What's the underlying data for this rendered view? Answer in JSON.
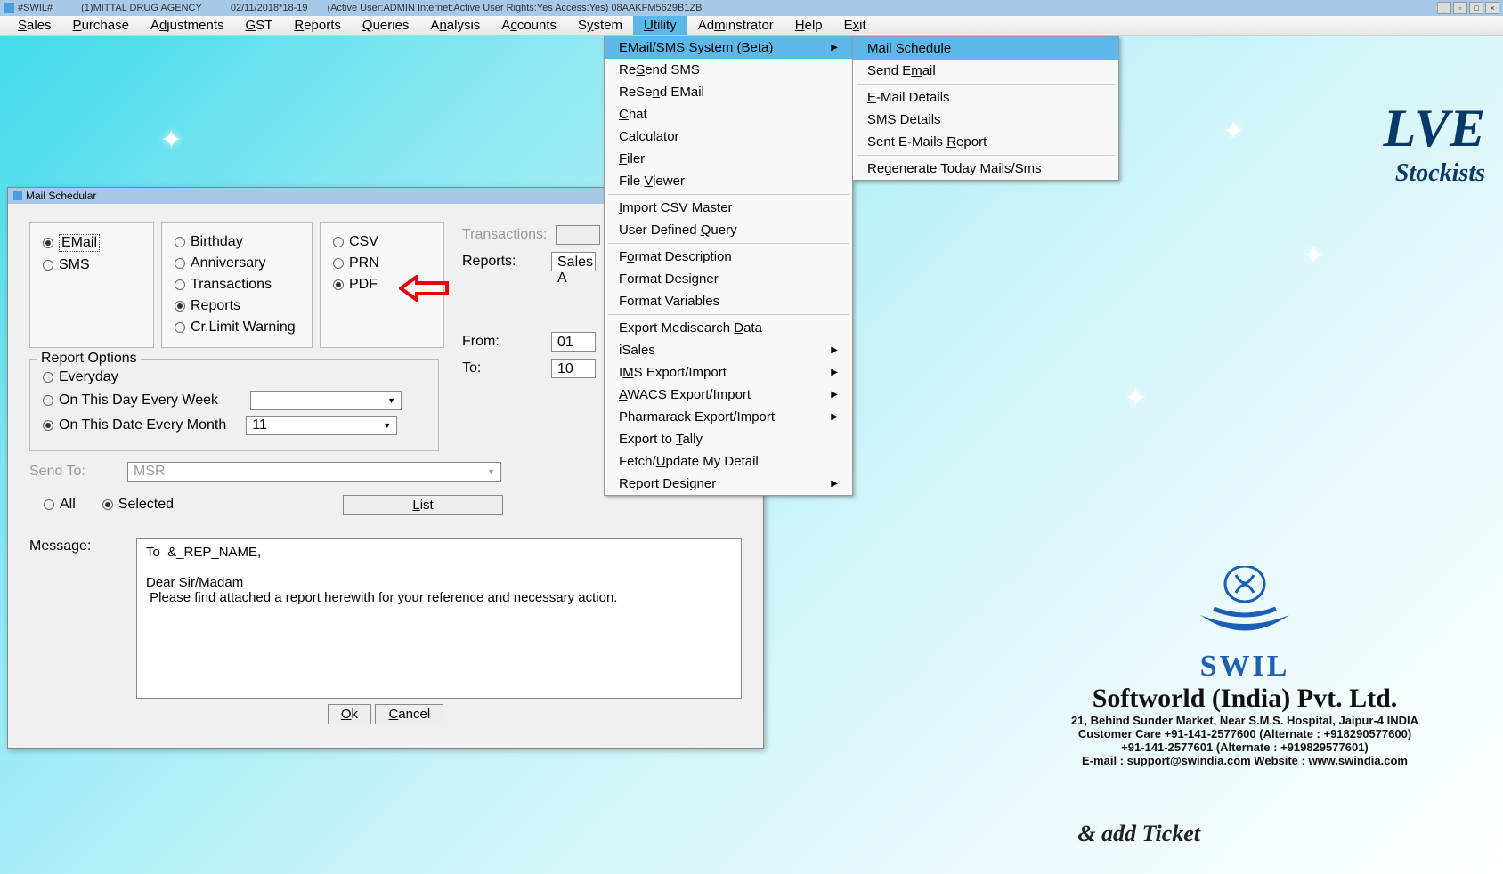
{
  "titlebar": {
    "app": "#SWIL#",
    "company": "(1)MITTAL DRUG AGENCY",
    "datetime": "02/11/2018*18-19",
    "status": "(Active User:ADMIN Internet:Active  User Rights:Yes Access:Yes) 08AAKFM5629B1ZB"
  },
  "menubar": {
    "items": [
      "Sales",
      "Purchase",
      "Adjustments",
      "GST",
      "Reports",
      "Queries",
      "Analysis",
      "Accounts",
      "System",
      "Utility",
      "Adminstrator",
      "Help",
      "Exit"
    ],
    "active": "Utility"
  },
  "utility_menu": {
    "items": [
      {
        "label": "EMail/SMS System (Beta)",
        "submenu": true,
        "highlighted": true,
        "u": "E"
      },
      {
        "label": "ReSend SMS",
        "u": "S"
      },
      {
        "label": "ReSend EMail",
        "u": "n"
      },
      {
        "label": "Chat",
        "u": "C"
      },
      {
        "label": "Calculator",
        "u": "a"
      },
      {
        "label": "Filer",
        "u": "F"
      },
      {
        "label": "File Viewer",
        "u": "V"
      },
      {
        "sep": true
      },
      {
        "label": "Import CSV Master",
        "u": "I"
      },
      {
        "label": "User Defined Query",
        "u": "Q"
      },
      {
        "sep": true
      },
      {
        "label": "Format Description",
        "u": "o"
      },
      {
        "label": "Format Designer"
      },
      {
        "label": "Format Variables"
      },
      {
        "sep": true
      },
      {
        "label": "Export Medisearch Data",
        "u": "D"
      },
      {
        "label": "iSales",
        "submenu": true
      },
      {
        "label": "IMS Export/Import",
        "submenu": true,
        "u": "M"
      },
      {
        "label": "AWACS Export/Import",
        "submenu": true,
        "u": "A"
      },
      {
        "label": "Pharmarack Export/Import",
        "submenu": true
      },
      {
        "label": "Export to Tally",
        "u": "T"
      },
      {
        "label": "Fetch/Update My Detail",
        "u": "U"
      },
      {
        "label": "Report Designer",
        "submenu": true
      }
    ]
  },
  "email_submenu": {
    "items": [
      {
        "label": "Mail Schedule",
        "highlighted": true
      },
      {
        "label": "Send Email",
        "u": "m"
      },
      {
        "sep": true
      },
      {
        "label": "E-Mail Details",
        "u": "E"
      },
      {
        "label": "SMS Details",
        "u": "S"
      },
      {
        "label": "Sent E-Mails Report",
        "u": "R"
      },
      {
        "sep": true
      },
      {
        "label": "Regenerate Today Mails/Sms",
        "u": "T"
      }
    ]
  },
  "mail_dialog": {
    "title": "Mail Schedular",
    "type_group": {
      "email": "EMail",
      "sms": "SMS",
      "selected": "EMail"
    },
    "category_group": {
      "options": [
        "Birthday",
        "Anniversary",
        "Transactions",
        "Reports",
        "Cr.Limit Warning"
      ],
      "selected": "Reports"
    },
    "format_group": {
      "options": [
        "CSV",
        "PRN",
        "PDF"
      ],
      "selected": "PDF"
    },
    "right_labels": {
      "transactions": "Transactions:",
      "reports": "Reports:",
      "reports_value": "Sales A",
      "from": "From:",
      "from_value": "01",
      "to": "To:",
      "to_value": "10"
    },
    "report_options": {
      "legend": "Report Options",
      "everyday": "Everyday",
      "weekly": "On This Day Every Week",
      "monthly": "On This Date Every Month",
      "selected": "monthly",
      "monthly_value": "11"
    },
    "sendto": {
      "label": "Send To:",
      "value": "MSR"
    },
    "selection": {
      "all": "All",
      "selected": "Selected",
      "checked": "Selected",
      "list_btn": "List"
    },
    "message": {
      "label": "Message:",
      "text": "To  &_REP_NAME,\n\nDear Sir/Madam\n Please find attached a report herewith for your reference and necessary action."
    },
    "buttons": {
      "ok": "Ok",
      "cancel": "Cancel"
    }
  },
  "brand": {
    "name": "SWIL",
    "company": "Softworld (India) Pvt. Ltd.",
    "addr": "21, Behind Sunder Market, Near S.M.S. Hospital, Jaipur-4 INDIA",
    "care1": "Customer Care     +91-141-2577600 (Alternate : +918290577600)",
    "care2": "+91-141-2577601 (Alternate : +919829577601)",
    "email": "E-mail : support@swindia.com   Website : www.swindia.com"
  },
  "bg": {
    "lve": "LVE",
    "stock": "Stockists",
    "ticket": "& add Ticket"
  }
}
